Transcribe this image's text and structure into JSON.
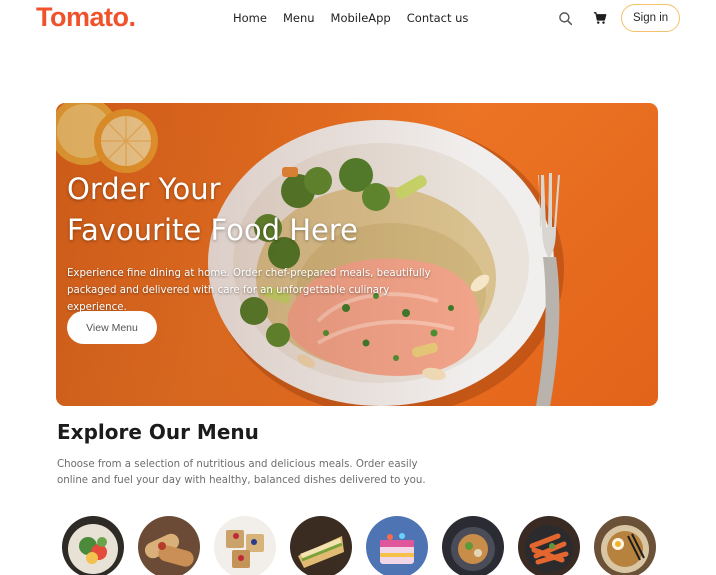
{
  "brand": {
    "name": "Tomato.",
    "color": "#f0522c"
  },
  "nav": {
    "links": [
      "Home",
      "Menu",
      "MobileApp",
      "Contact us"
    ],
    "search_icon": "search-icon",
    "cart_icon": "cart-icon",
    "signin_label": "Sign in"
  },
  "hero": {
    "title_line1": "Order Your",
    "title_line2": "Favourite Food Here",
    "description": "Experience fine dining at home. Order chef-prepared meals, beautifully packaged and delivered with care for an unforgettable culinary experience.",
    "cta_label": "View Menu",
    "background_color": "#ec7424"
  },
  "explore": {
    "title": "Explore Our Menu",
    "description": "Choose from a selection of nutritious and delicious meals. Order easily online and fuel your day with healthy, balanced dishes delivered to you."
  },
  "categories": [
    {
      "image": "salad-dish",
      "color": "#4a8a3a"
    },
    {
      "image": "rolls-dish",
      "color": "#b9894e"
    },
    {
      "image": "dessert-dish",
      "color": "#c9a36a"
    },
    {
      "image": "sandwich-dish",
      "color": "#d7b16a"
    },
    {
      "image": "cake-dish",
      "color": "#5a7fbf"
    },
    {
      "image": "pure-veg-dish",
      "color": "#3b3d46"
    },
    {
      "image": "pasta-dish",
      "color": "#c8502a"
    },
    {
      "image": "noodles-dish",
      "color": "#b38a4e"
    }
  ]
}
